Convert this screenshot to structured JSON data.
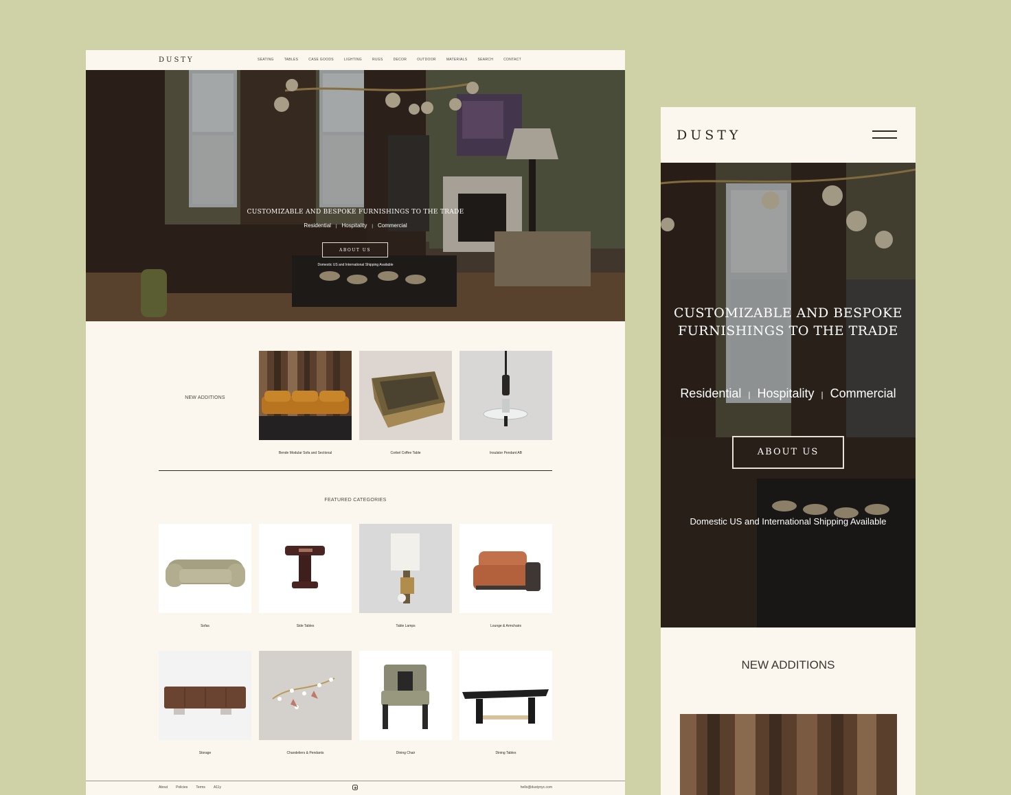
{
  "desktop": {
    "logo": "DUSTY",
    "nav": [
      "SEATING",
      "TABLES",
      "CASE GOODS",
      "LIGHTING",
      "RUGS",
      "DECOR",
      "OUTDOOR",
      "MATERIALS",
      "SEARCH",
      "CONTACT"
    ],
    "hero": {
      "headline": "CUSTOMIZABLE AND BESPOKE FURNISHINGS TO THE TRADE",
      "segments": [
        "Residential",
        "Hospitality",
        "Commercial"
      ],
      "separator": "|",
      "cta": "ABOUT US",
      "shipping": "Domestic US and International Shipping Available"
    },
    "new_additions": {
      "label": "NEW ADDITIONS",
      "items": [
        {
          "name": "Bende Modular Sofa and Sectional",
          "image": "sofa-photo"
        },
        {
          "name": "Corbel Coffee Table",
          "image": "coffee-table-photo"
        },
        {
          "name": "Insulator Pendant AB",
          "image": "pendant-photo"
        }
      ]
    },
    "featured_categories": {
      "label": "FEATURED CATEGORIES",
      "items": [
        {
          "name": "Sofas"
        },
        {
          "name": "Side Tables"
        },
        {
          "name": "Table Lamps"
        },
        {
          "name": "Lounge & Armchairs"
        },
        {
          "name": "Storage"
        },
        {
          "name": "Chandeliers & Pendants"
        },
        {
          "name": "Dining Chair"
        },
        {
          "name": "Dining Tables"
        }
      ]
    },
    "footer": {
      "links": [
        "About",
        "Policies",
        "Terms",
        "A11y"
      ],
      "social_icon": "instagram-icon",
      "email": "hello@dustynyc.com"
    }
  },
  "mobile": {
    "logo": "DUSTY",
    "menu_icon": "hamburger-icon",
    "hero": {
      "headline_line1": "CUSTOMIZABLE AND BESPOKE",
      "headline_line2": "FURNISHINGS TO THE TRADE",
      "segments": [
        "Residential",
        "Hospitality",
        "Commercial"
      ],
      "separator": "|",
      "cta": "ABOUT US",
      "shipping": "Domestic US and International Shipping Available"
    },
    "new_additions_label": "NEW ADDITIONS"
  },
  "colors": {
    "background": "#cfd1a7",
    "page": "#fbf7ef",
    "text": "#2a2622"
  }
}
